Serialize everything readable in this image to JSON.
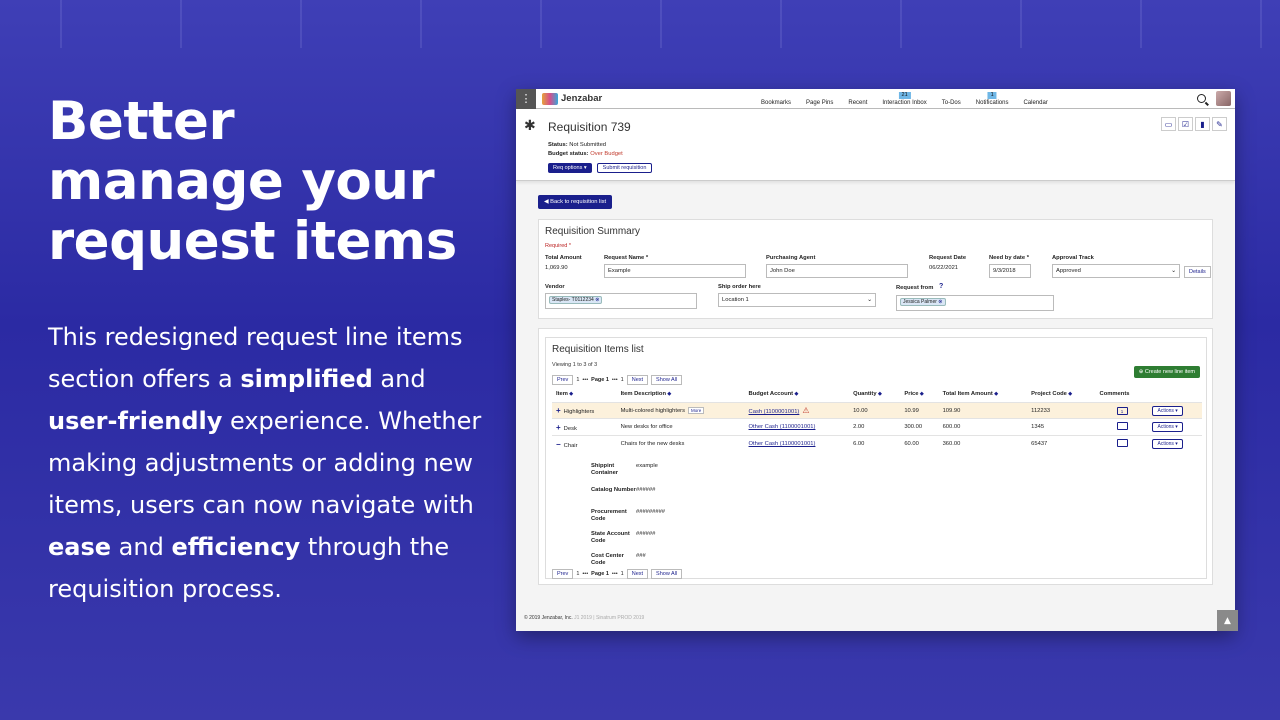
{
  "promo": {
    "headline": [
      "Better",
      "manage your",
      "request items"
    ],
    "body": [
      {
        "t": "This redesigned request line items section offers a ",
        "b": false
      },
      {
        "t": "simplified",
        "b": true
      },
      {
        "t": " and ",
        "b": false
      },
      {
        "t": "user-friendly",
        "b": true
      },
      {
        "t": " experience. Whether making adjustments or adding new items, users can now navigate with ",
        "b": false
      },
      {
        "t": "ease",
        "b": true
      },
      {
        "t": " and ",
        "b": false
      },
      {
        "t": "efficiency",
        "b": true
      },
      {
        "t": " through the requisition process.",
        "b": false
      }
    ]
  },
  "app": {
    "brand": "Jenzabar",
    "nav": [
      {
        "label": "Bookmarks",
        "badge": ""
      },
      {
        "label": "Page Pins",
        "badge": ""
      },
      {
        "label": "Recent",
        "badge": ""
      },
      {
        "label": "Interaction Inbox",
        "badge": "21"
      },
      {
        "label": "To-Dos",
        "badge": ""
      },
      {
        "label": "Notifications",
        "badge": "1"
      },
      {
        "label": "Calendar",
        "badge": ""
      }
    ]
  },
  "header": {
    "title": "Requisition 739",
    "status_label": "Status:",
    "status_value": "Not Submitted",
    "budget_label": "Budget status:",
    "budget_value": "Over Budget",
    "req_options": "Req options ▾",
    "submit": "Submit requisition"
  },
  "back_button": "Back to requisition list",
  "summary": {
    "title": "Requisition Summary",
    "required": "Required *",
    "total_amount_label": "Total Amount",
    "total_amount": "1,069.90",
    "request_name_label": "Request Name *",
    "request_name": "Example",
    "purchasing_agent_label": "Purchasing Agent",
    "purchasing_agent": "John Doe",
    "request_date_label": "Request Date",
    "request_date": "06/22/2021",
    "need_by_label": "Need by date *",
    "need_by": "9/3/2018",
    "approval_track_label": "Approval Track",
    "approval_track": "Approved",
    "details_btn": "Details",
    "vendor_label": "Vendor",
    "vendor": "Staples- T0112234",
    "ship_label": "Ship order here",
    "ship": "Location 1",
    "request_from_label": "Request from",
    "request_from": "Jessica Palmer"
  },
  "items": {
    "title": "Requisition Items list",
    "viewing": "Viewing 1 to 3 of 3",
    "pager": {
      "prev": "Prev",
      "first": "1",
      "dots": "•••",
      "page": "Page 1",
      "last": "1",
      "next": "Next",
      "show_all": "Show All"
    },
    "create": "Create new line item",
    "columns": [
      "Item",
      "Item Description",
      "Budget Account",
      "Quantity",
      "Price",
      "Total Item Amount",
      "Project Code",
      "Comments"
    ],
    "rows": [
      {
        "toggle": "+",
        "item": "Highlighters",
        "desc": "Multi-colored highlighters",
        "more": "More",
        "account": "Cash (1100001001)",
        "warn": true,
        "qty": "10.00",
        "price": "10.99",
        "total": "109.90",
        "project": "112233",
        "comments": "1",
        "actions": "Actions ▾"
      },
      {
        "toggle": "+",
        "item": "Desk",
        "desc": "New desks for office",
        "more": "",
        "account": "Other Cash (1100001001)",
        "warn": false,
        "qty": "2.00",
        "price": "300.00",
        "total": "600.00",
        "project": "1345",
        "comments": "",
        "actions": "Actions ▾"
      },
      {
        "toggle": "−",
        "item": "Chair",
        "desc": "Chairs for the new desks",
        "more": "",
        "account": "Other Cash (1100001001)",
        "warn": false,
        "qty": "6.00",
        "price": "60.00",
        "total": "360.00",
        "project": "65437",
        "comments": "",
        "actions": "Actions ▾"
      }
    ],
    "details": [
      {
        "label": "Shippint Container",
        "value": "example"
      },
      {
        "label": "Catalog Number",
        "value": "######"
      },
      {
        "label": "Procurement Code",
        "value": "#########"
      },
      {
        "label": "State Account Code",
        "value": "######"
      },
      {
        "label": "Cost Center Code",
        "value": "###"
      }
    ]
  },
  "footer": {
    "copyright": "© 2019 Jenzabar, Inc.",
    "version": "J1 2019 | Sinatrum PROD 2019"
  },
  "colors": {
    "accent": "#1a1f8c",
    "create": "#2e7d32",
    "warning": "#c0392b",
    "highlight_row": "#fcf1dc"
  }
}
